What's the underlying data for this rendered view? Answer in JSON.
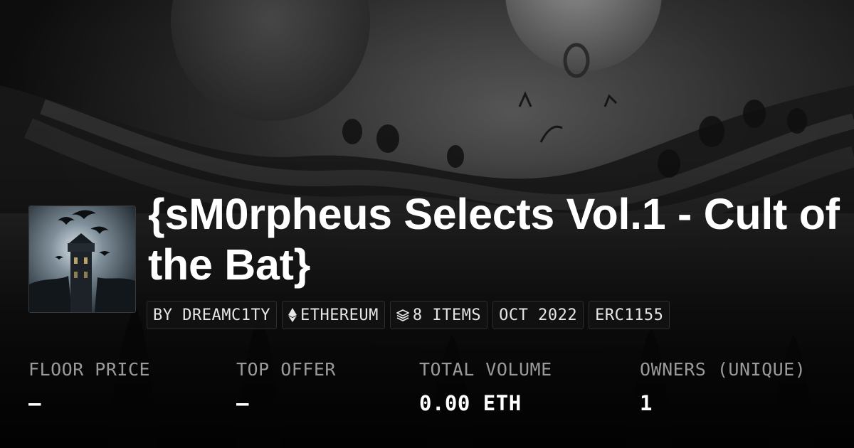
{
  "collection": {
    "title_line1": "{sM0rpheus Selects Vol.1 - Cult of",
    "title_line2": "the Bat}",
    "thumbnail_icon": "gothic-tower-bats-artwork"
  },
  "tags": [
    {
      "label": "BY DREAMC1TY",
      "icon": ""
    },
    {
      "label": "ETHEREUM",
      "icon": "ethereum-icon"
    },
    {
      "label": "8 ITEMS",
      "icon": "layers-icon"
    },
    {
      "label": "OCT 2022",
      "icon": ""
    },
    {
      "label": "ERC1155",
      "icon": ""
    }
  ],
  "stats": [
    {
      "label": "FLOOR PRICE",
      "value": "–"
    },
    {
      "label": "TOP OFFER",
      "value": "–"
    },
    {
      "label": "TOTAL VOLUME",
      "value": "0.00 ETH"
    },
    {
      "label": "OWNERS (UNIQUE)",
      "value": "1"
    }
  ],
  "colors": {
    "background": "#0c0c0c",
    "title": "#ffffff",
    "stat_label": "#9a9a9a",
    "stat_value": "#ffffff",
    "tag_text": "#e6e6e6"
  }
}
